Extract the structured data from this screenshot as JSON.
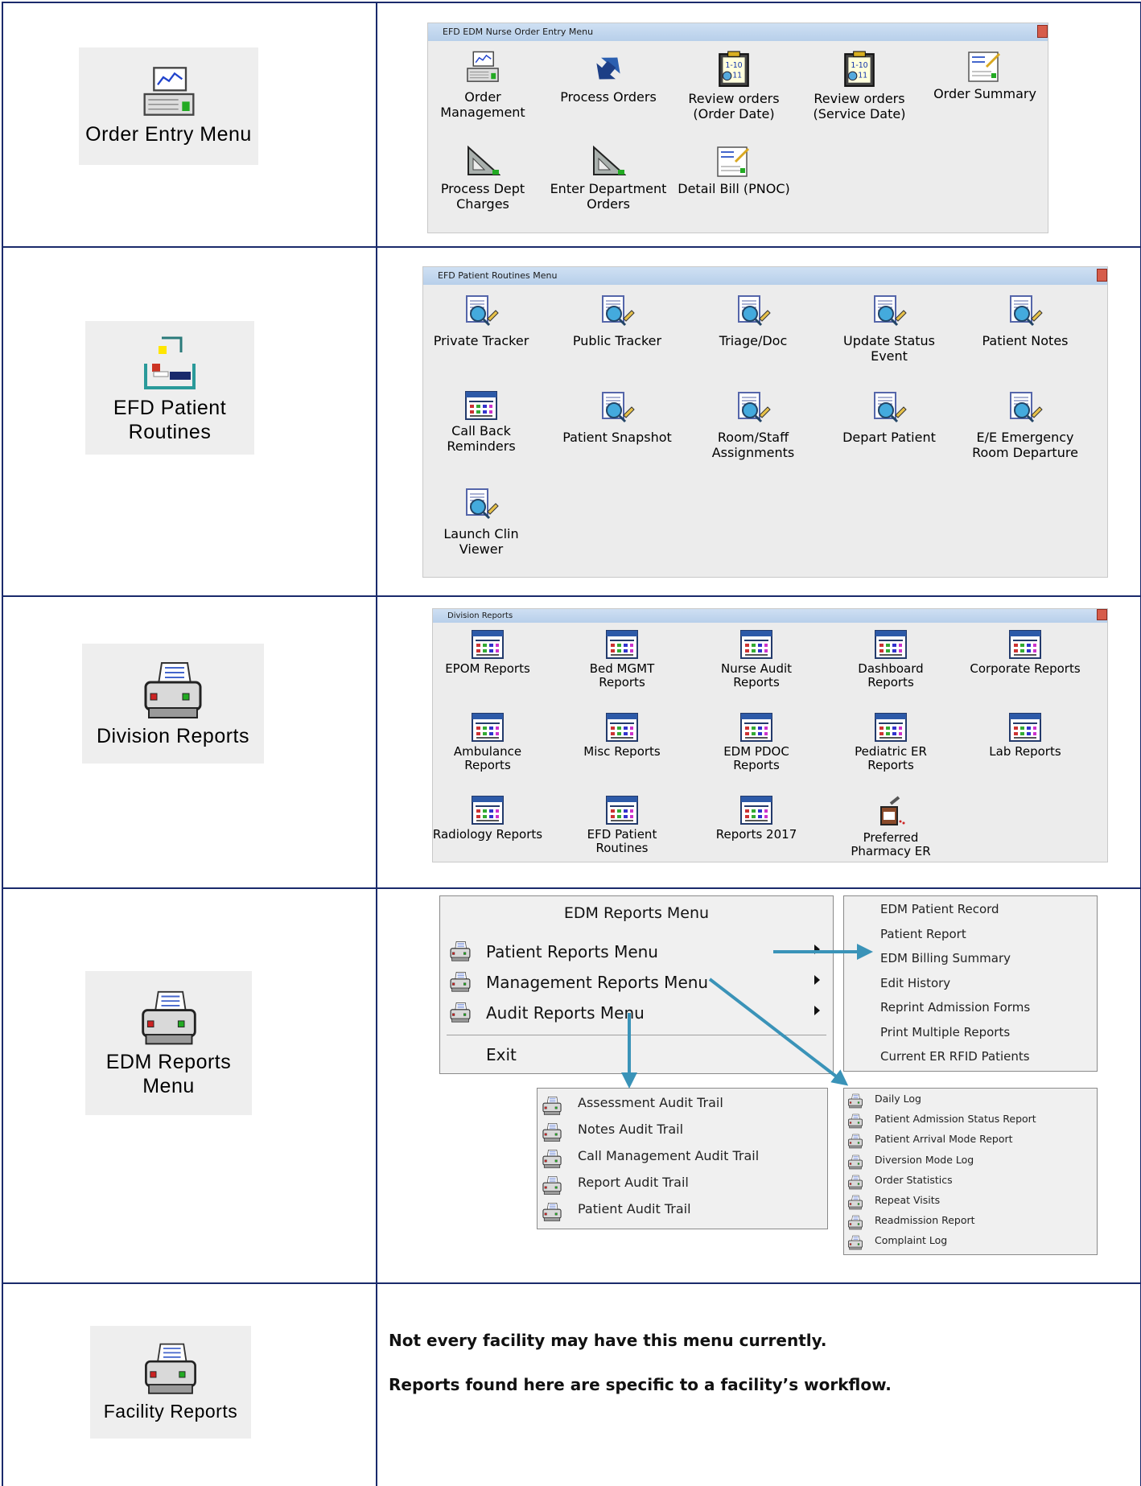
{
  "rows": {
    "order_entry": {
      "tile_label": "Order Entry Menu",
      "window_title": "EFD EDM Nurse Order Entry Menu",
      "items": [
        {
          "label_1": "Order",
          "label_2": "Management",
          "icon": "computer-chart-icon"
        },
        {
          "label_1": "Process Orders",
          "label_2": "",
          "icon": "blue-arrows-icon"
        },
        {
          "label_1": "Review orders",
          "label_2": "(Order Date)",
          "icon": "clipboard-calendar-icon"
        },
        {
          "label_1": "Review orders",
          "label_2": "(Service Date)",
          "icon": "clipboard-calendar-icon"
        },
        {
          "label_1": "Order Summary",
          "label_2": "",
          "icon": "document-pen-icon"
        },
        {
          "label_1": "Process Dept",
          "label_2": "Charges",
          "icon": "set-square-icon"
        },
        {
          "label_1": "Enter Department",
          "label_2": "Orders",
          "icon": "set-square-icon"
        },
        {
          "label_1": "Detail Bill (PNOC)",
          "label_2": "",
          "icon": "document-pen-icon"
        }
      ]
    },
    "patient_routines": {
      "tile_label_1": "EFD Patient",
      "tile_label_2": "Routines",
      "window_title": "EFD Patient Routines Menu",
      "items": [
        {
          "label_1": "Private Tracker",
          "label_2": "",
          "icon": "document-magnifier-icon"
        },
        {
          "label_1": "Public Tracker",
          "label_2": "",
          "icon": "document-magnifier-icon"
        },
        {
          "label_1": "Triage/Doc",
          "label_2": "",
          "icon": "document-magnifier-icon"
        },
        {
          "label_1": "Update Status",
          "label_2": "Event",
          "icon": "document-magnifier-icon"
        },
        {
          "label_1": "Patient Notes",
          "label_2": "",
          "icon": "document-magnifier-icon"
        },
        {
          "label_1": "Call Back",
          "label_2": "Reminders",
          "icon": "report-window-icon"
        },
        {
          "label_1": "Patient Snapshot",
          "label_2": "",
          "icon": "document-magnifier-icon"
        },
        {
          "label_1": "Room/Staff",
          "label_2": "Assignments",
          "icon": "document-magnifier-icon"
        },
        {
          "label_1": "Depart Patient",
          "label_2": "",
          "icon": "document-magnifier-icon"
        },
        {
          "label_1": "E/E Emergency",
          "label_2": "Room Departure",
          "icon": "document-magnifier-icon"
        },
        {
          "label_1": "Launch Clin",
          "label_2": "Viewer",
          "icon": "document-magnifier-icon"
        }
      ]
    },
    "division_reports": {
      "tile_label": "Division Reports",
      "window_title": "Division Reports",
      "items": [
        {
          "label_1": "EPOM Reports",
          "label_2": "",
          "icon": "report-window-icon"
        },
        {
          "label_1": "Bed MGMT",
          "label_2": "Reports",
          "icon": "report-window-icon"
        },
        {
          "label_1": "Nurse Audit",
          "label_2": "Reports",
          "icon": "report-window-icon"
        },
        {
          "label_1": "Dashboard",
          "label_2": "Reports",
          "icon": "report-window-icon"
        },
        {
          "label_1": "Corporate Reports",
          "label_2": "",
          "icon": "report-window-icon"
        },
        {
          "label_1": "Ambulance",
          "label_2": "Reports",
          "icon": "report-window-icon"
        },
        {
          "label_1": "Misc Reports",
          "label_2": "",
          "icon": "report-window-icon"
        },
        {
          "label_1": "EDM PDOC",
          "label_2": "Reports",
          "icon": "report-window-icon"
        },
        {
          "label_1": "Pediatric ER",
          "label_2": "Reports",
          "icon": "report-window-icon"
        },
        {
          "label_1": "Lab Reports",
          "label_2": "",
          "icon": "report-window-icon"
        },
        {
          "label_1": "Radiology Reports",
          "label_2": "",
          "icon": "report-window-icon"
        },
        {
          "label_1": "EFD Patient",
          "label_2": "Routines",
          "icon": "report-window-icon"
        },
        {
          "label_1": "Reports 2017",
          "label_2": "",
          "icon": "report-window-icon"
        },
        {
          "label_1": "Preferred",
          "label_2": "Pharmacy ER",
          "icon": "pharmacy-bottle-icon"
        }
      ]
    },
    "edm_reports": {
      "tile_label_1": "EDM Reports",
      "tile_label_2": "Menu",
      "menu_title": "EDM Reports Menu",
      "menu_items": [
        {
          "label": "Patient Reports Menu",
          "has_submenu": true
        },
        {
          "label": "Management Reports Menu",
          "has_submenu": true
        },
        {
          "label": "Audit Reports Menu",
          "has_submenu": true
        }
      ],
      "exit_label": "Exit",
      "patient_reports": [
        "EDM Patient Record",
        "Patient Report",
        "EDM Billing Summary",
        "Edit History",
        "Reprint Admission Forms",
        "Print Multiple Reports",
        "Current ER RFID Patients"
      ],
      "audit_reports": [
        "Assessment Audit Trail",
        "Notes Audit Trail",
        "Call Management Audit Trail",
        "Report Audit Trail",
        "Patient Audit Trail"
      ],
      "management_reports": [
        "Daily Log",
        "Patient Admission Status Report",
        "Patient Arrival Mode Report",
        "Diversion Mode Log",
        "Order Statistics",
        "Repeat Visits",
        "Readmission Report",
        "Complaint Log"
      ]
    },
    "facility_reports": {
      "tile_label": "Facility Reports",
      "note_1": "Not every facility may have this menu currently.",
      "note_2": "Reports found here are specific to a facility’s workflow."
    }
  },
  "colors": {
    "border": "#1a2a6b",
    "arrow": "#3a93b8",
    "tile_bg": "#eeeeee",
    "window_bg": "#ececec"
  }
}
